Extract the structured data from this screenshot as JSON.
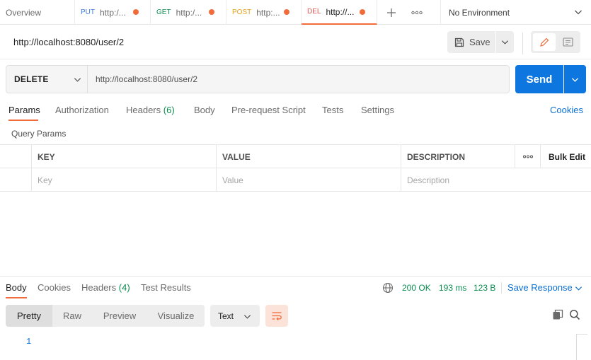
{
  "tabs": {
    "overview": "Overview",
    "items": [
      {
        "method": "PUT",
        "url": "http:/...",
        "method_color": "#3a7bd5"
      },
      {
        "method": "GET",
        "url": "http:/...",
        "method_color": "#0b8c4f"
      },
      {
        "method": "POST",
        "url": "http:...",
        "method_color": "#e3a21a"
      },
      {
        "method": "DEL",
        "url": "http://...",
        "method_color": "#d9534f"
      }
    ],
    "environment": "No Environment"
  },
  "request": {
    "title": "http://localhost:8080/user/2",
    "save_label": "Save",
    "method": "DELETE",
    "url": "http://localhost:8080/user/2",
    "send_label": "Send"
  },
  "request_tabs": {
    "params": "Params",
    "authorization": "Authorization",
    "headers": "Headers",
    "headers_count": "(6)",
    "body": "Body",
    "prerequest": "Pre-request Script",
    "tests": "Tests",
    "settings": "Settings",
    "cookies": "Cookies"
  },
  "query_params": {
    "title": "Query Params",
    "columns": {
      "key": "KEY",
      "value": "VALUE",
      "description": "DESCRIPTION",
      "bulk_edit": "Bulk Edit"
    },
    "placeholders": {
      "key": "Key",
      "value": "Value",
      "description": "Description"
    }
  },
  "response": {
    "tabs": {
      "body": "Body",
      "cookies": "Cookies",
      "headers": "Headers",
      "headers_count": "(4)",
      "test_results": "Test Results"
    },
    "status": "200 OK",
    "time": "193 ms",
    "size": "123 B",
    "save_response": "Save Response",
    "formats": [
      "Pretty",
      "Raw",
      "Preview",
      "Visualize"
    ],
    "type": "Text",
    "line_number": "1"
  },
  "colors": {
    "accent": "#f26b3a",
    "primary": "#0d76df",
    "success": "#0b8c4f"
  }
}
